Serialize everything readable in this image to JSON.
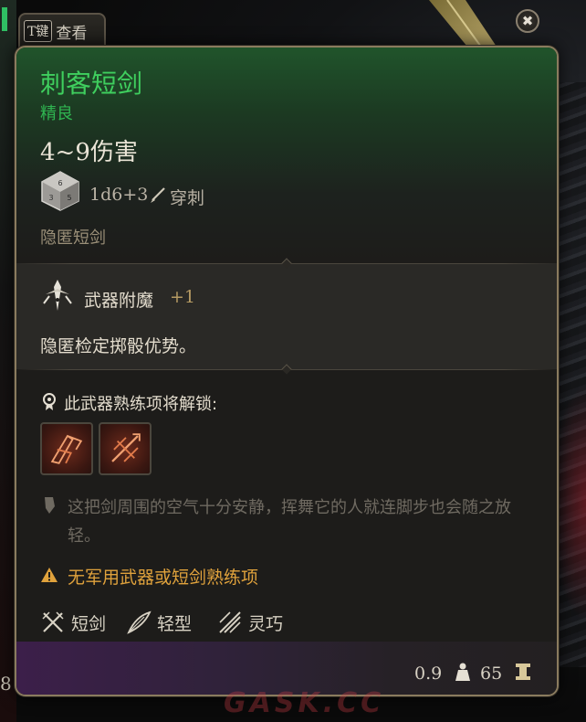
{
  "view_tab": {
    "key": "T键",
    "label": "查看"
  },
  "item": {
    "name": "刺客短剑",
    "rarity": "精良",
    "damage": "4~9伤害",
    "damage_roll": "1d6+3",
    "damage_type": "穿刺",
    "category": "隐匿短剑"
  },
  "enchantment": {
    "label": "武器附魔",
    "bonus": "+1",
    "description": "隐匿检定掷骰优势。"
  },
  "proficiency": {
    "unlock_text": "此武器熟练项将解锁:",
    "actions": [
      "action-icon-1",
      "action-icon-2"
    ]
  },
  "lore": "这把剑周围的空气十分安静，挥舞它的人就连脚步也会随之放轻。",
  "warning": "无军用武器或短剑熟练项",
  "properties": [
    {
      "icon": "crossed-swords-icon",
      "label": "短剑"
    },
    {
      "icon": "feather-icon",
      "label": "轻型"
    },
    {
      "icon": "finesse-icon",
      "label": "灵巧"
    }
  ],
  "footer": {
    "weight": "0.9",
    "value": "65"
  },
  "background": {
    "left_number": "8"
  },
  "watermark": "GASK.CC",
  "colors": {
    "rarity_green": "#3fcf5e",
    "warning_orange": "#e0a23c",
    "border_gold": "#8a7b5e"
  }
}
